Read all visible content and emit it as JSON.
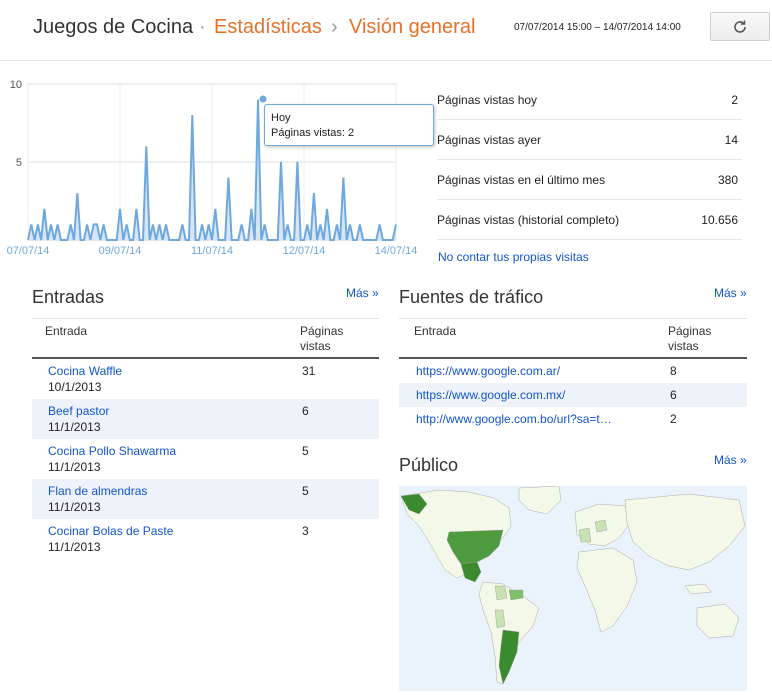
{
  "header": {
    "app": "Juegos de Cocina",
    "dot": "·",
    "section": "Estadísticas",
    "sep": "›",
    "page": "Visión general",
    "date_range": "07/07/2014 15:00 – 14/07/2014 14:00",
    "refresh_icon": "refresh-icon"
  },
  "chart_data": {
    "type": "area",
    "ylim": [
      0,
      10
    ],
    "yticks": [
      "10",
      "5"
    ],
    "xticks": [
      "07/07/14",
      "09/07/14",
      "11/07/14",
      "12/07/14",
      "14/07/14"
    ],
    "values": [
      0,
      1,
      0,
      1,
      0,
      2,
      0,
      1,
      0,
      1,
      0,
      0,
      0,
      1,
      0,
      3,
      0,
      0,
      1,
      0,
      1,
      1,
      0,
      1,
      0,
      0,
      0,
      0,
      2,
      0,
      1,
      0,
      0,
      2,
      0,
      0,
      6,
      0,
      1,
      0,
      1,
      0,
      1,
      0,
      0,
      0,
      0,
      1,
      0,
      0,
      8,
      0,
      0,
      1,
      0,
      1,
      0,
      2,
      0,
      0,
      0,
      4,
      0,
      0,
      0,
      1,
      0,
      0,
      2,
      0,
      9,
      0,
      1,
      0,
      0,
      0,
      0,
      5,
      0,
      1,
      0,
      0,
      5,
      0,
      0,
      1,
      0,
      3,
      0,
      1,
      0,
      2,
      0,
      0,
      1,
      0,
      4,
      0,
      1,
      0,
      0,
      1,
      0,
      0,
      0,
      0,
      0,
      1,
      0,
      0,
      0,
      0,
      1
    ],
    "color": "#6fa8dc",
    "tooltip": {
      "title": "Hoy",
      "label": "Páginas vistas: 2"
    }
  },
  "stats": [
    {
      "label": "Páginas vistas hoy",
      "value": "2"
    },
    {
      "label": "Páginas vistas ayer",
      "value": "14"
    },
    {
      "label": "Páginas vistas en el último mes",
      "value": "380"
    },
    {
      "label": "Páginas vistas (historial completo)",
      "value": "10.656"
    }
  ],
  "own_visits_link": "No contar tus propias visitas",
  "entradas": {
    "title": "Entradas",
    "more": "Más »",
    "col1": "Entrada",
    "col2a": "Páginas",
    "col2b": "vistas",
    "rows": [
      {
        "title": "Cocina Waffle",
        "date": "10/1/2013",
        "views": "31"
      },
      {
        "title": "Beef pastor",
        "date": "11/1/2013",
        "views": "6"
      },
      {
        "title": "Cocina Pollo Shawarma",
        "date": "11/1/2013",
        "views": "5"
      },
      {
        "title": "Flan de almendras",
        "date": "11/1/2013",
        "views": "5"
      },
      {
        "title": "Cocinar Bolas de Paste",
        "date": "11/1/2013",
        "views": "3"
      }
    ]
  },
  "fuentes": {
    "title": "Fuentes de tráfico",
    "more": "Más »",
    "col1": "Entrada",
    "col2a": "Páginas",
    "col2b": "vistas",
    "rows": [
      {
        "url": "https://www.google.com.ar/",
        "views": "8"
      },
      {
        "url": "https://www.google.com.mx/",
        "views": "6"
      },
      {
        "url": "http://www.google.com.bo/url?sa=t…",
        "views": "2"
      }
    ]
  },
  "publico": {
    "title": "Público",
    "more": "Más »",
    "colors": {
      "water": "#eaf3fb",
      "land": "#f3f8e8",
      "low": "#c9e2b3",
      "mid": "#7fbf6a",
      "high": "#3a8a2e"
    }
  }
}
